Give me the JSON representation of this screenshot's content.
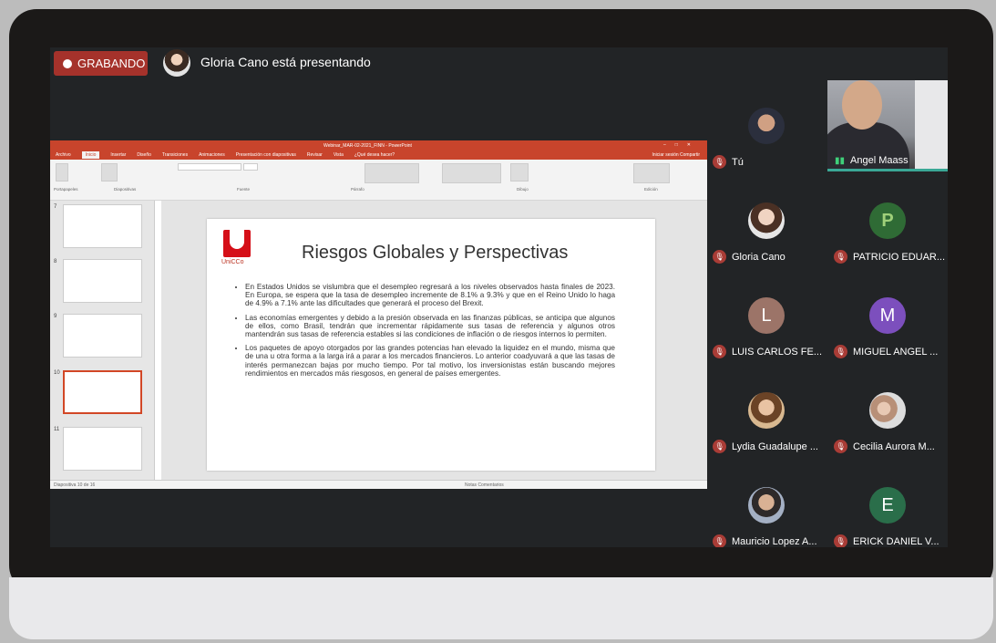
{
  "recording": {
    "label": "GRABANDO"
  },
  "presenter_banner": "Gloria Cano está presentando",
  "powerpoint": {
    "title": "Webinar_MAR-02-2021_FINN - PowerPoint",
    "tabs": [
      "Archivo",
      "Inicio",
      "Insertar",
      "Diseño",
      "Transiciones",
      "Animaciones",
      "Presentación con diapositivas",
      "Revisar",
      "Vista",
      "¿Qué desea hacer?"
    ],
    "share": "Iniciar sesión  Compartir",
    "ribbon_groups": [
      "Portapapeles",
      "Diapositivas",
      "Fuente",
      "Párrafo",
      "Dibujo",
      "Edición"
    ],
    "thumb_numbers": [
      "7",
      "8",
      "9",
      "10",
      "11"
    ],
    "status_left": "Diapositiva 10 de 16",
    "status_right": "Notas   Comentarios"
  },
  "slide": {
    "logo_text": "UniCCo",
    "title": "Riesgos Globales y Perspectivas",
    "bullets": [
      "En Estados Unidos se vislumbra que el desempleo regresará a los niveles observados hasta finales de 2023. En Europa, se espera que la tasa de desempleo incremente de 8.1% a 9.3% y que en el Reino Unido lo haga de 4.9% a 7.1% ante las dificultades que generará el proceso del Brexit.",
      "Las economías emergentes y debido a la presión observada en las finanzas públicas, se anticipa que algunos de ellos, como Brasil, tendrán que incrementar rápidamente sus tasas de referencia y algunos otros mantendrán sus tasas de referencia estables si las condiciones de inflación o de riesgos internos lo permiten.",
      "Los paquetes de apoyo otorgados por las grandes potencias han elevado la liquidez en el mundo, misma que de una u otra forma a la larga irá a parar a los mercados financieros. Lo anterior coadyuvará a que las tasas de interés permanezcan bajas por mucho tiempo. Por tal motivo, los inversionistas están buscando mejores rendimientos en mercados más riesgosos, en general de países emergentes."
    ]
  },
  "participants": {
    "you": "Tú",
    "video_name": "Angel Maass",
    "list": [
      {
        "name": "Gloria Cano",
        "initial": "",
        "color": "#cfd3d8"
      },
      {
        "name": "PATRICIO EDUAR...",
        "initial": "P",
        "color": "#2f6b35"
      },
      {
        "name": "LUIS CARLOS FE...",
        "initial": "L",
        "color": "#9c7468"
      },
      {
        "name": "MIGUEL ANGEL ...",
        "initial": "M",
        "color": "#7c4fbd"
      },
      {
        "name": "Lydia Guadalupe ...",
        "initial": "",
        "color": "#d8b890"
      },
      {
        "name": "Cecilia Aurora M...",
        "initial": "",
        "color": "#c9b6a6"
      },
      {
        "name": "Mauricio Lopez A...",
        "initial": "",
        "color": "#a4b0c4"
      },
      {
        "name": "ERICK DANIEL V...",
        "initial": "E",
        "color": "#2a6e4a"
      }
    ]
  }
}
